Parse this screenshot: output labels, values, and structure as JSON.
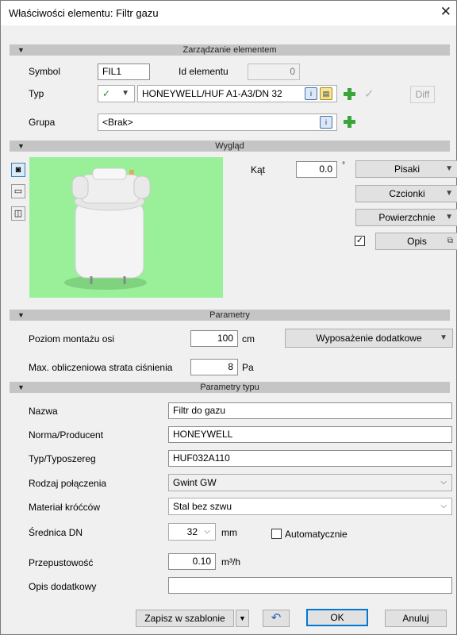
{
  "window": {
    "title": "Właściwości elementu: Filtr gazu",
    "close_icon": "close-icon"
  },
  "zarzadzanie": {
    "header": "Zarządzanie elementem",
    "symbol_label": "Symbol",
    "symbol_value": "FIL1",
    "id_label": "Id elementu",
    "id_value": "0",
    "typ_label": "Typ",
    "typ_value": "HONEYWELL/HUF A1-A3/DN 32",
    "diff_label": "Diff",
    "grupa_label": "Grupa",
    "grupa_value": "<Brak>"
  },
  "wyglad": {
    "header": "Wygląd",
    "kat_label": "Kąt",
    "kat_value": "0.0",
    "kat_unit": "°",
    "pisaki": "Pisaki",
    "czcionki": "Czcionki",
    "powierzchnie": "Powierzchnie",
    "opis": "Opis",
    "opis_checked": true
  },
  "parametry": {
    "header": "Parametry",
    "poziom_label": "Poziom montażu osi",
    "poziom_value": "100",
    "poziom_unit": "cm",
    "wyposazenie": "Wyposażenie dodatkowe",
    "strata_label": "Max. obliczeniowa strata ciśnienia",
    "strata_value": "8",
    "strata_unit": "Pa"
  },
  "parametry_typu": {
    "header": "Parametry typu",
    "nazwa_label": "Nazwa",
    "nazwa_value": "Filtr do gazu",
    "norma_label": "Norma/Producent",
    "norma_value": "HONEYWELL",
    "typ_label": "Typ/Typoszereg",
    "typ_value": "HUF032A110",
    "rodzaj_label": "Rodzaj połączenia",
    "rodzaj_value": "Gwint GW",
    "material_label": "Materiał króćców",
    "material_value": "Stal bez szwu",
    "srednica_label": "Średnica DN",
    "srednica_value": "32",
    "srednica_unit": "mm",
    "auto_label": "Automatycznie",
    "auto_checked": false,
    "przep_label": "Przepustowość",
    "przep_value": "0.10",
    "przep_unit": "m³/h",
    "opis_label": "Opis dodatkowy",
    "opis_value": ""
  },
  "footer": {
    "zapisz": "Zapisz w szablonie",
    "ok": "OK",
    "anuluj": "Anuluj"
  }
}
